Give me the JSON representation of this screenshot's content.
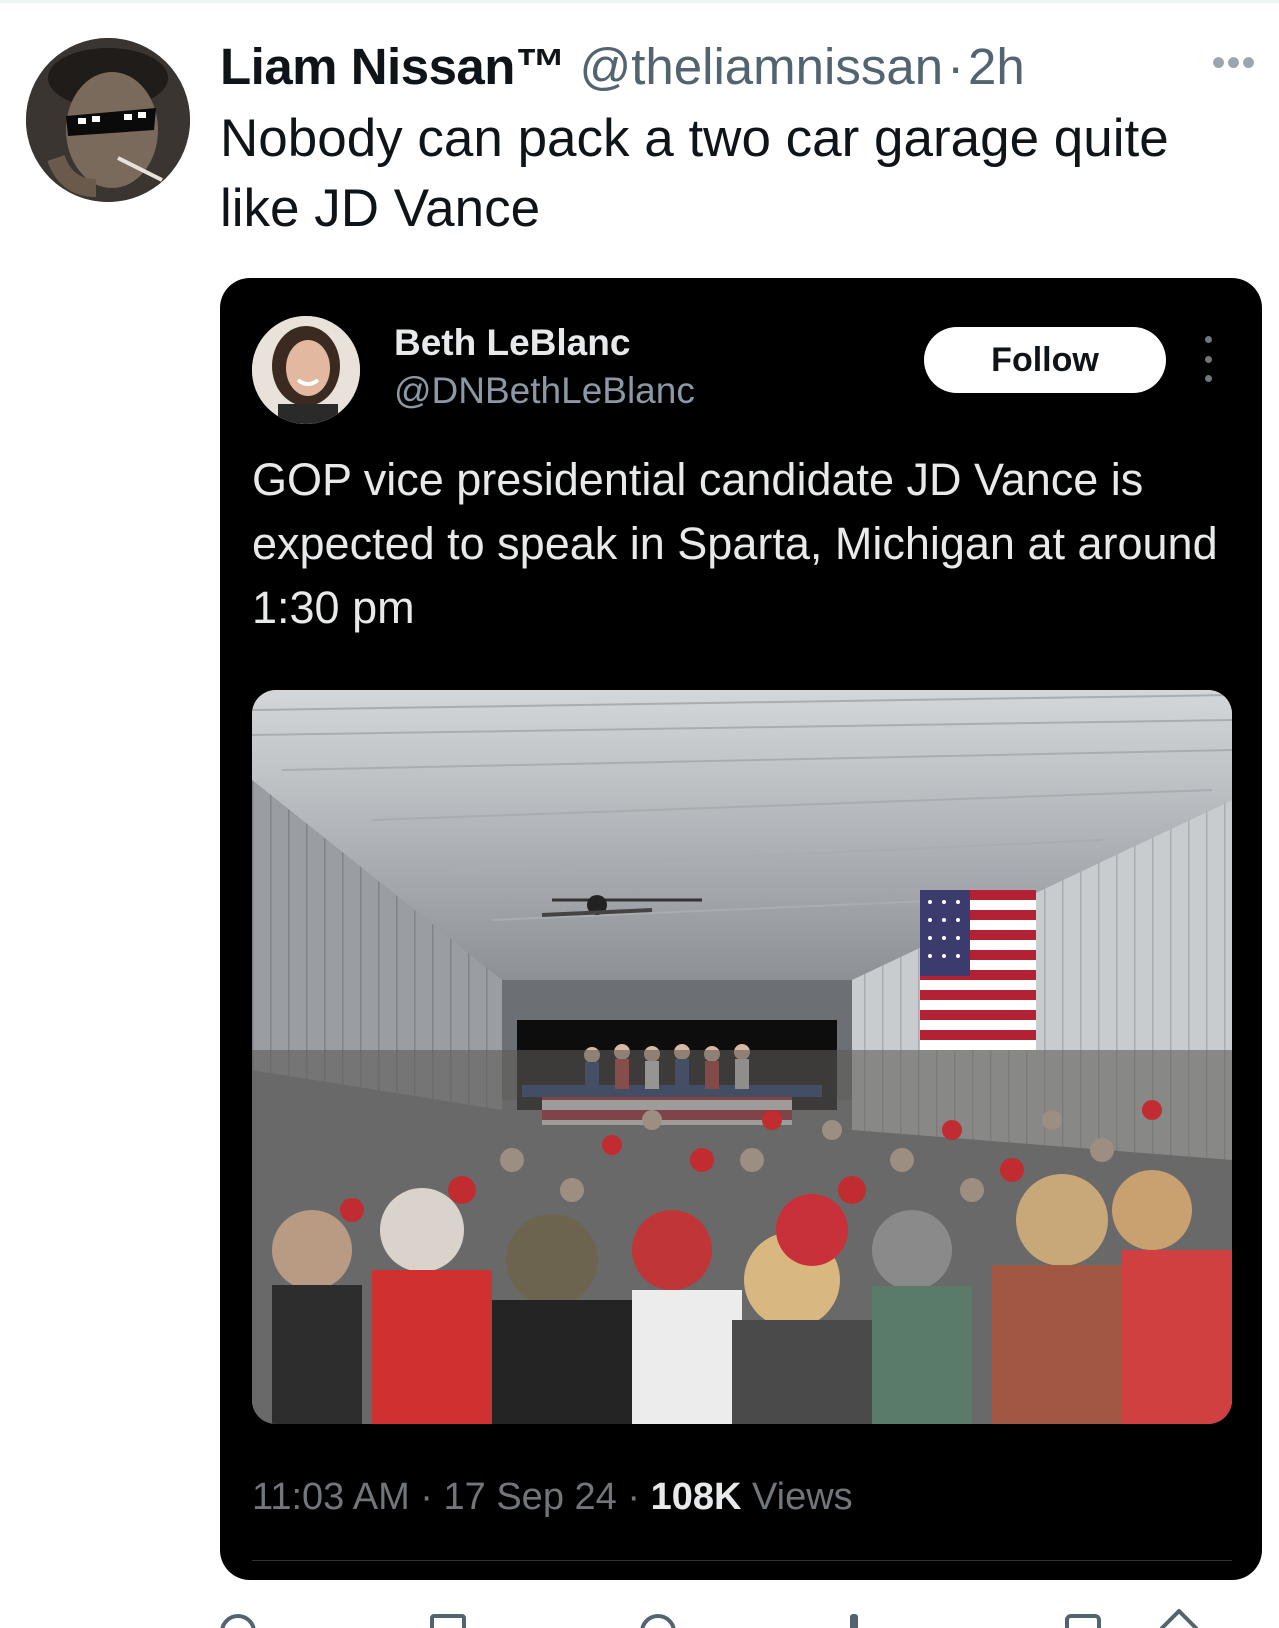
{
  "tweet": {
    "author": {
      "display_name": "Liam Nissan™",
      "handle": "@theliamnissan",
      "separator": "·",
      "time": "2h"
    },
    "more_icon": "more-horizontal-icon",
    "text": "Nobody can pack a two car garage quite like JD Vance"
  },
  "quoted": {
    "author": {
      "name": "Beth LeBlanc",
      "handle": "@DNBethLeBlanc"
    },
    "follow_label": "Follow",
    "more_icon": "more-vertical-icon",
    "text": "GOP vice presidential candidate JD Vance is expected to speak in Sparta, Michigan at around 1:30 pm",
    "meta": {
      "time": "11:03 AM",
      "sep1": "·",
      "date": "17 Sep 24",
      "sep2": "·",
      "views_count": "108K",
      "views_label": "Views"
    }
  },
  "actions": [
    {
      "icon": "reply-icon"
    },
    {
      "icon": "retweet-icon"
    },
    {
      "icon": "like-icon"
    },
    {
      "icon": "views-icon"
    },
    {
      "icon": "bookmark-icon"
    },
    {
      "icon": "share-icon"
    }
  ],
  "colors": {
    "text_primary": "#0f1419",
    "text_secondary": "#536471",
    "embed_bg": "#000000",
    "embed_text": "#e7e9ea",
    "embed_muted": "#71767b"
  }
}
